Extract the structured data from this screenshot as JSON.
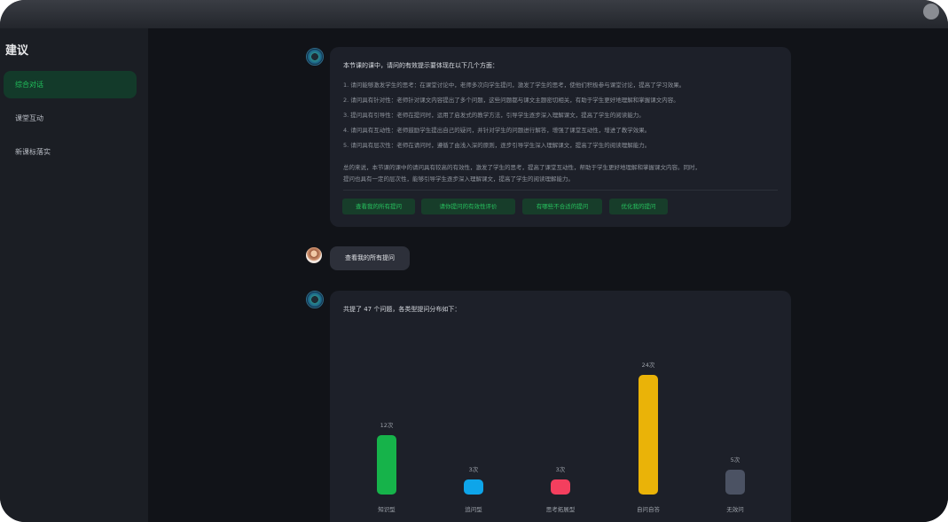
{
  "sidebar": {
    "title": "建议",
    "items": [
      {
        "label": "综合对话",
        "active": true
      },
      {
        "label": "课堂互动",
        "active": false
      },
      {
        "label": "新课标落实",
        "active": false
      }
    ]
  },
  "message1": {
    "title": "本节课的课中，请问的有效提示要体现在以下几个方面：",
    "items": [
      "1. 请问能够激发学生的思考：在课堂讨论中，老师多次向学生提问，激发了学生的思考，使他们积极参与课堂讨论，提高了学习效果。",
      "2. 请问具有针对性：老师针对课文内容提出了多个问题，这些问题都与课文主题密切相关，有助于学生更好地理解和掌握课文内容。",
      "3. 提问具有引导性：老师在提问时，运用了启发式的教学方法，引导学生逐步深入理解课文，提高了学生的阅读能力。",
      "4. 请问具有互动性：老师鼓励学生提出自己的疑问，并针对学生的问题进行解答，增强了课堂互动性，增进了教学效果。",
      "5. 请问具有层次性：老师在请问时，遵循了由浅入深的原则，逐步引导学生深入理解课文，提高了学生的阅读理解能力。"
    ],
    "summary_1": "总的来说，本节课的课中的请问具有较高的有效性，激发了学生的思考，提高了课堂互动性，帮助于学生更好地理解和掌握课文内容。同时，",
    "summary_2": "提问也具有一定的层次性，能够引导学生逐步深入理解课文，提高了学生的阅读理解能力。",
    "chips": [
      "查看我的所有提问",
      "请你提问的有效性评价",
      "有哪些不合适的提问",
      "优化我的提问"
    ]
  },
  "user_message": "查看我的所有提问",
  "message2": {
    "title": "共提了 47 个问题，各类型提问分布如下："
  },
  "chart_data": {
    "type": "bar",
    "categories": [
      "知识型",
      "追问型",
      "思考拓展型",
      "自问自答",
      "无效问"
    ],
    "values": [
      12,
      3,
      3,
      24,
      5
    ],
    "value_labels": [
      "12次",
      "3次",
      "3次",
      "24次",
      "5次"
    ],
    "colors": [
      "#16b34a",
      "#0ea5e9",
      "#f43f5e",
      "#eab308",
      "#4b5263"
    ],
    "title": "",
    "xlabel": "",
    "ylabel": "",
    "ylim": [
      0,
      24
    ]
  }
}
